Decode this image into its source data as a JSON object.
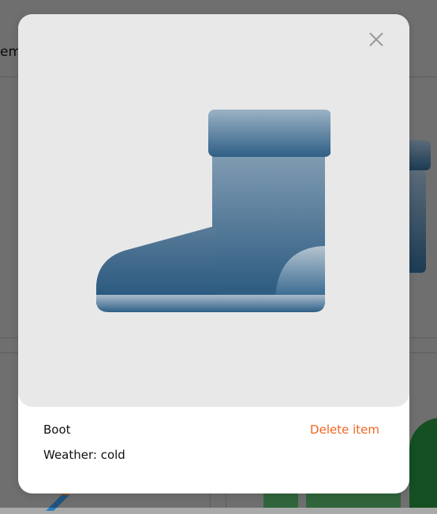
{
  "background": {
    "header_fragment": "em"
  },
  "modal": {
    "item_name": "Boot",
    "weather_label": "Weather: cold",
    "delete_label": "Delete item",
    "close_icon": "close-icon",
    "image_icon": "boot-icon"
  },
  "colors": {
    "accent": "#f26522",
    "boot_dark": "#2b5a80",
    "boot_light": "#8aa3b8",
    "image_bg": "#e8e8e8"
  }
}
